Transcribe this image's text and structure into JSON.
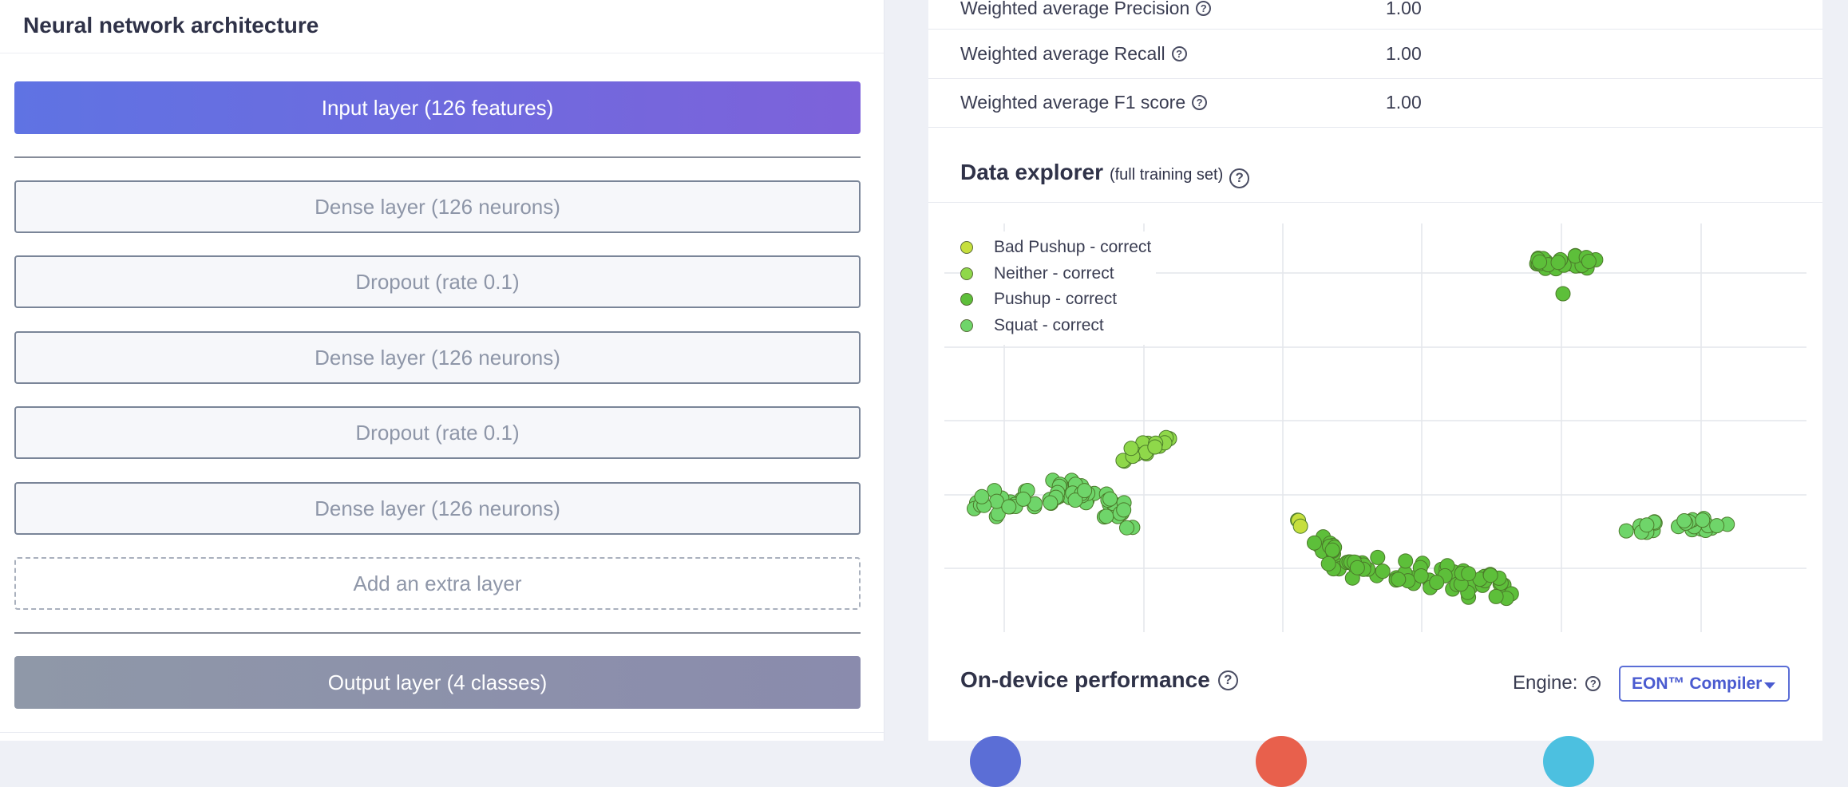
{
  "left": {
    "title": "Neural network architecture",
    "input_layer": "Input layer (126 features)",
    "layers": [
      "Dense layer (126 neurons)",
      "Dropout (rate 0.1)",
      "Dense layer (126 neurons)",
      "Dropout (rate 0.1)",
      "Dense layer (126 neurons)"
    ],
    "add_layer": "Add an extra layer",
    "output_layer": "Output layer (4 classes)"
  },
  "metrics": [
    {
      "label": "Weighted average Precision",
      "value": "1.00"
    },
    {
      "label": "Weighted average Recall",
      "value": "1.00"
    },
    {
      "label": "Weighted average F1 score",
      "value": "1.00"
    }
  ],
  "explorer": {
    "title": "Data explorer",
    "subtitle": "(full training set)"
  },
  "chart_data": {
    "type": "scatter",
    "grid": true,
    "series": [
      {
        "name": "Bad Pushup - correct",
        "color": "#c6df3d"
      },
      {
        "name": "Neither - correct",
        "color": "#8fd84a"
      },
      {
        "name": "Pushup - correct",
        "color": "#5dbf3a"
      },
      {
        "name": "Squat - correct",
        "color": "#6fd56a"
      }
    ]
  },
  "performance": {
    "title": "On-device performance",
    "engine_label": "Engine:",
    "engine_value": "EON™ Compiler",
    "circle_colors": [
      "#5b6ed6",
      "#e8604c",
      "#4cc0e0"
    ]
  },
  "icons": {
    "help": "help-circle-icon",
    "caret": "caret-down-icon"
  },
  "help_glyph": "?"
}
